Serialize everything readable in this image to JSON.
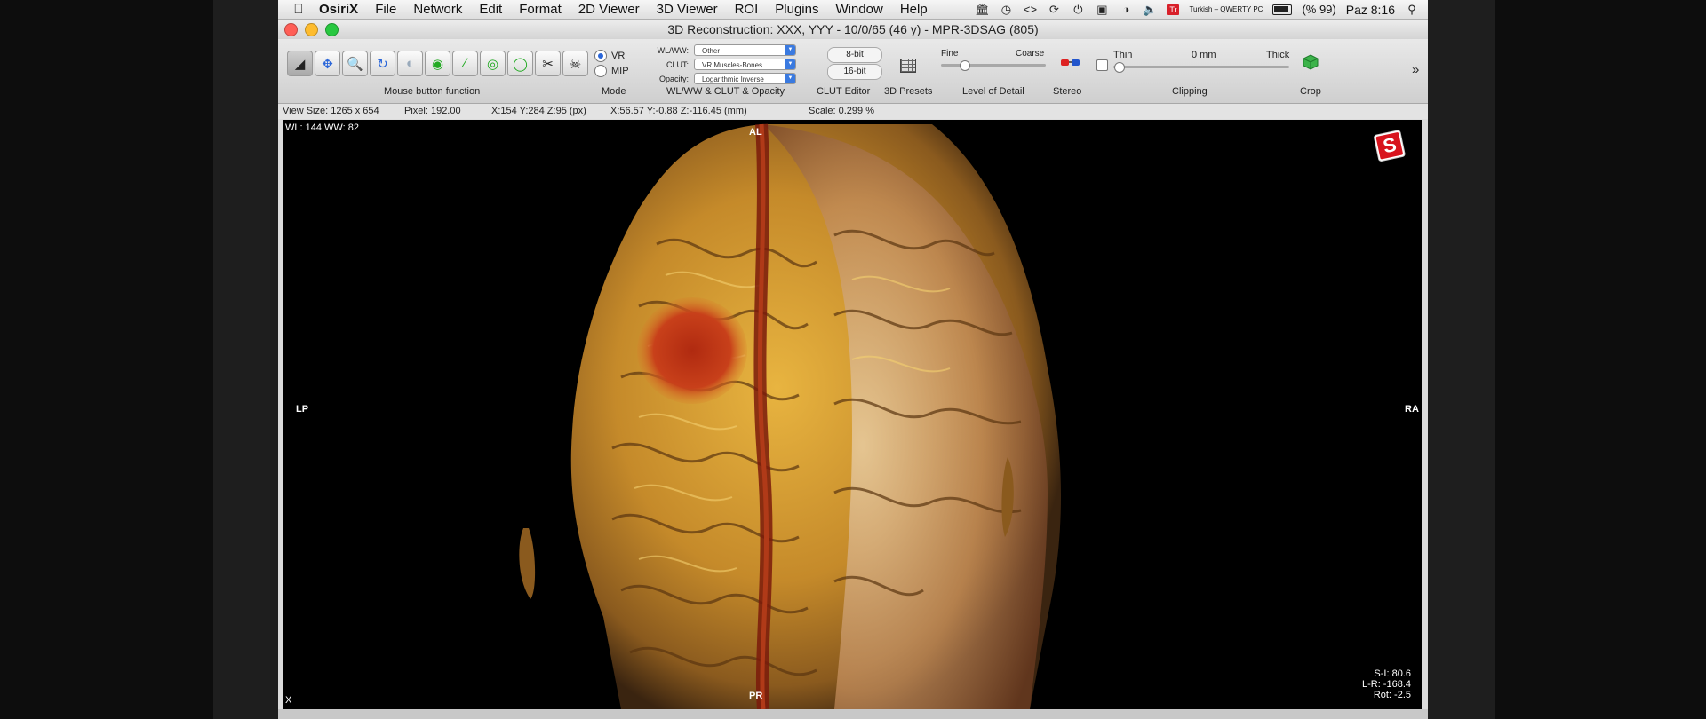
{
  "menubar": {
    "app_name": "OsiriX",
    "items": [
      "File",
      "Network",
      "Edit",
      "Format",
      "2D Viewer",
      "3D Viewer",
      "ROI",
      "Plugins",
      "Window",
      "Help"
    ],
    "keyboard_layout": "Turkish – QWERTY PC",
    "battery": "(% 99)",
    "clock": "Paz 8:16",
    "flag_letter": "Tr"
  },
  "window": {
    "title": "3D Reconstruction: XXX, YYY - 10/0/65 (46 y) - MPR-3DSAG (805)"
  },
  "toolbar": {
    "mouse_label": "Mouse button function",
    "mode_label": "Mode",
    "mode_vr": "VR",
    "mode_mip": "MIP",
    "wlww_group_label": "WL/WW & CLUT & Opacity",
    "wlww_label": "WL/WW:",
    "wlww_value": "Other",
    "clut_label": "CLUT:",
    "clut_value": "VR Muscles-Bones",
    "opacity_label": "Opacity:",
    "opacity_value": "Logarithmic Inverse",
    "bit8": "8-bit",
    "bit16": "16-bit",
    "clut_editor_label": "CLUT Editor",
    "presets_label": "3D Presets",
    "lod_label": "Level of Detail",
    "lod_fine": "Fine",
    "lod_coarse": "Coarse",
    "stereo_label": "Stereo",
    "clip_thin": "Thin",
    "clip_value": "0 mm",
    "clip_thick": "Thick",
    "clipping_label": "Clipping",
    "crop_label": "Crop",
    "overflow": "»"
  },
  "infobar": {
    "view_size": "View Size: 1265 x 654",
    "pixel": "Pixel: 192.00",
    "px_coords": "X:154 Y:284 Z:95 (px)",
    "mm_coords": "X:56.57 Y:-0.88 Z:-116.45 (mm)",
    "scale": "Scale: 0.299 %"
  },
  "viewer": {
    "wlww": "WL: 144 WW: 82",
    "top": "AL",
    "bottom": "PR",
    "left": "LP",
    "right": "RA",
    "corner_x": "X",
    "si": "S-I: 80.6",
    "lr": "L-R: -168.4",
    "rot": "Rot: -2.5",
    "logo_letter": "S"
  }
}
